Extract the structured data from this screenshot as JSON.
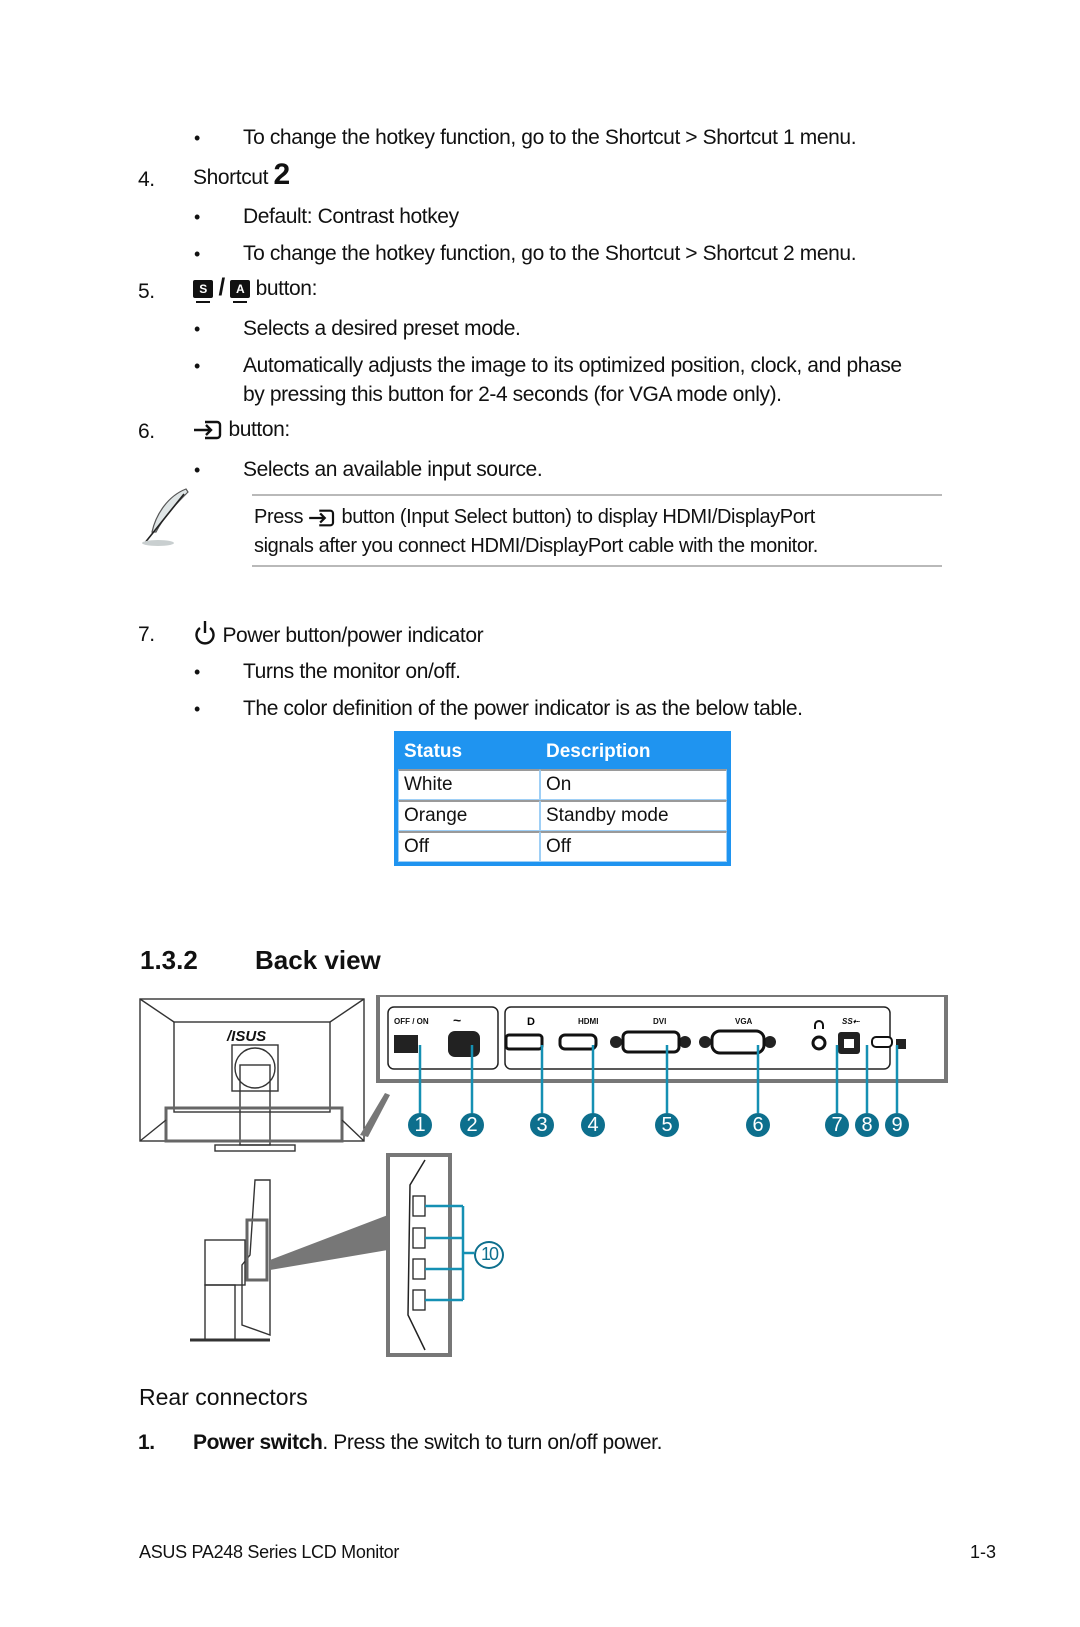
{
  "items": [
    {
      "type": "bullet",
      "text": "To change the hotkey function, go to the Shortcut > Shortcut 1 menu."
    },
    {
      "type": "numbered",
      "number": "4.",
      "label": "Shortcut",
      "label_suffix": "2"
    },
    {
      "type": "bullet",
      "text": "Default: Contrast hotkey"
    },
    {
      "type": "bullet",
      "text": "To change the hotkey function, go to the Shortcut > Shortcut 2 menu."
    },
    {
      "type": "numbered",
      "number": "5.",
      "key1": "S",
      "separator": "/",
      "key2": "A",
      "label": "button:"
    },
    {
      "type": "bullet",
      "text": "Selects a desired preset mode."
    },
    {
      "type": "bullet",
      "text": "Automatically adjusts the image to its optimized position, clock, and phase",
      "text_line2": "by pressing this button for 2-4 seconds (for VGA mode only)."
    },
    {
      "type": "numbered",
      "number": "6.",
      "label": "button:"
    },
    {
      "type": "bullet",
      "text": "Selects an available input source."
    },
    {
      "type": "numbered",
      "number": "7.",
      "label": "Power button/power indicator"
    },
    {
      "type": "bullet",
      "text": "Turns the monitor on/off."
    },
    {
      "type": "bullet",
      "text": "The color definition of the power indicator is as the below table."
    }
  ],
  "bullet_glyph": "•",
  "note": {
    "line1_prefix": "Press",
    "line1_suffix": "button (Input Select button) to display HDMI/DisplayPort",
    "line2": "signals after you connect HDMI/DisplayPort cable with the monitor."
  },
  "power_table": {
    "header_color": "#1f94f0",
    "headers": [
      "Status",
      "Description"
    ],
    "rows": [
      [
        "White",
        "On"
      ],
      [
        "Orange",
        "Standby mode"
      ],
      [
        "Off",
        "Off"
      ]
    ]
  },
  "section": {
    "number": "1.3.2",
    "title": "Back view"
  },
  "diagram": {
    "port_labels": {
      "power": "OFF / ON",
      "ac": "~",
      "hdmi": "HDMI",
      "dvi": "DVI",
      "vga": "VGA",
      "usb": "SS⇠"
    },
    "callouts": [
      "1",
      "2",
      "3",
      "4",
      "5",
      "6",
      "7",
      "8",
      "9"
    ],
    "usb_callout": "10",
    "callout_color": "#0d6f8d",
    "logo": "/ISUS"
  },
  "rear": {
    "heading": "Rear connectors",
    "item1_number": "1.",
    "item1_bold": "Power switch",
    "item1_text": ". Press the switch to turn on/off power."
  },
  "footer": {
    "title": "ASUS PA248 Series LCD Monitor",
    "page": "1-3"
  }
}
